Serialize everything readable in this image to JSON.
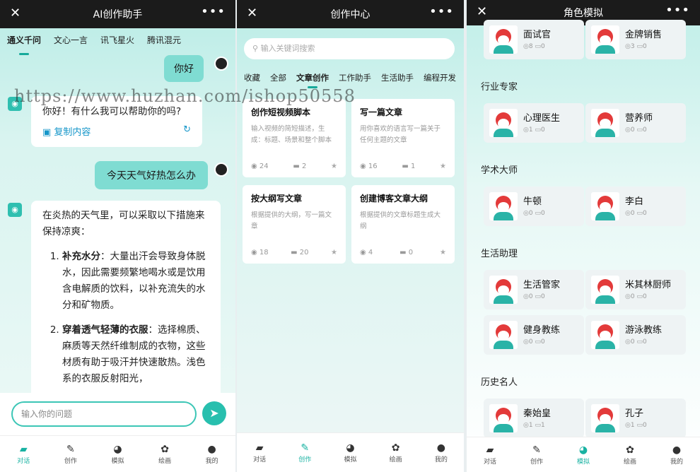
{
  "screen1": {
    "title": "AI创作助手",
    "tabs": [
      "通义千问",
      "文心一言",
      "讯飞星火",
      "腾讯混元"
    ],
    "messages": {
      "user1": "你好",
      "bot1": "你好！有什么我可以帮助你的吗?",
      "copy_label": "复制内容",
      "user2": "今天天气好热怎么办",
      "bot2_intro": "在炎热的天气里，可以采取以下措施来保持凉爽：",
      "bot2_items": [
        {
          "head": "补充水分",
          "body": "：大量出汗会导致身体脱水，因此需要频繁地喝水或是饮用含电解质的饮料，以补充流失的水分和矿物质。"
        },
        {
          "head": "穿着透气轻薄的衣服",
          "body": "：选择棉质、麻质等天然纤维制成的衣物，这些材质有助于吸汗并快速散热。浅色系的衣服反射阳光，"
        }
      ]
    },
    "input_placeholder": "输入你的问题"
  },
  "screen2": {
    "title": "创作中心",
    "search_placeholder": "输入关键词搜索",
    "tabs": [
      "收藏",
      "全部",
      "文章创作",
      "工作助手",
      "生活助手",
      "编程开发"
    ],
    "cards": [
      {
        "title": "创作短视频脚本",
        "desc": "输入视频的简短描述，生成：标题、场景和整个脚本",
        "views": "24",
        "comments": "2"
      },
      {
        "title": "写一篇文章",
        "desc": "用你喜欢的语言写一篇关于任何主题的文章",
        "views": "16",
        "comments": "1"
      },
      {
        "title": "按大纲写文章",
        "desc": "根据提供的大纲，写一篇文章",
        "views": "18",
        "comments": "20"
      },
      {
        "title": "创建博客文章大纲",
        "desc": "根据提供的文章标题生成大纲",
        "views": "4",
        "comments": "0"
      }
    ]
  },
  "screen3": {
    "title": "角色模拟",
    "top_roles": [
      {
        "name": "面试官",
        "views": "8",
        "comments": "0"
      },
      {
        "name": "金牌销售",
        "views": "3",
        "comments": "0"
      }
    ],
    "sections": [
      {
        "name": "行业专家",
        "roles": [
          {
            "name": "心理医生",
            "views": "1",
            "comments": "0"
          },
          {
            "name": "营养师",
            "views": "0",
            "comments": "0"
          }
        ]
      },
      {
        "name": "学术大师",
        "roles": [
          {
            "name": "牛顿",
            "views": "0",
            "comments": "0"
          },
          {
            "name": "李白",
            "views": "0",
            "comments": "0"
          }
        ]
      },
      {
        "name": "生活助理",
        "roles": [
          {
            "name": "生活管家",
            "views": "0",
            "comments": "0"
          },
          {
            "name": "米其林厨师",
            "views": "0",
            "comments": "0"
          },
          {
            "name": "健身教练",
            "views": "0",
            "comments": "0"
          },
          {
            "name": "游泳教练",
            "views": "0",
            "comments": "0"
          }
        ]
      },
      {
        "name": "历史名人",
        "roles": [
          {
            "name": "秦始皇",
            "views": "1",
            "comments": "1"
          },
          {
            "name": "孔子",
            "views": "1",
            "comments": "0"
          }
        ]
      }
    ]
  },
  "nav": [
    "对话",
    "创作",
    "模拟",
    "绘画",
    "我的"
  ],
  "watermark": "https://www.huzhan.com/ishop50558",
  "accent": "#18b2a2"
}
